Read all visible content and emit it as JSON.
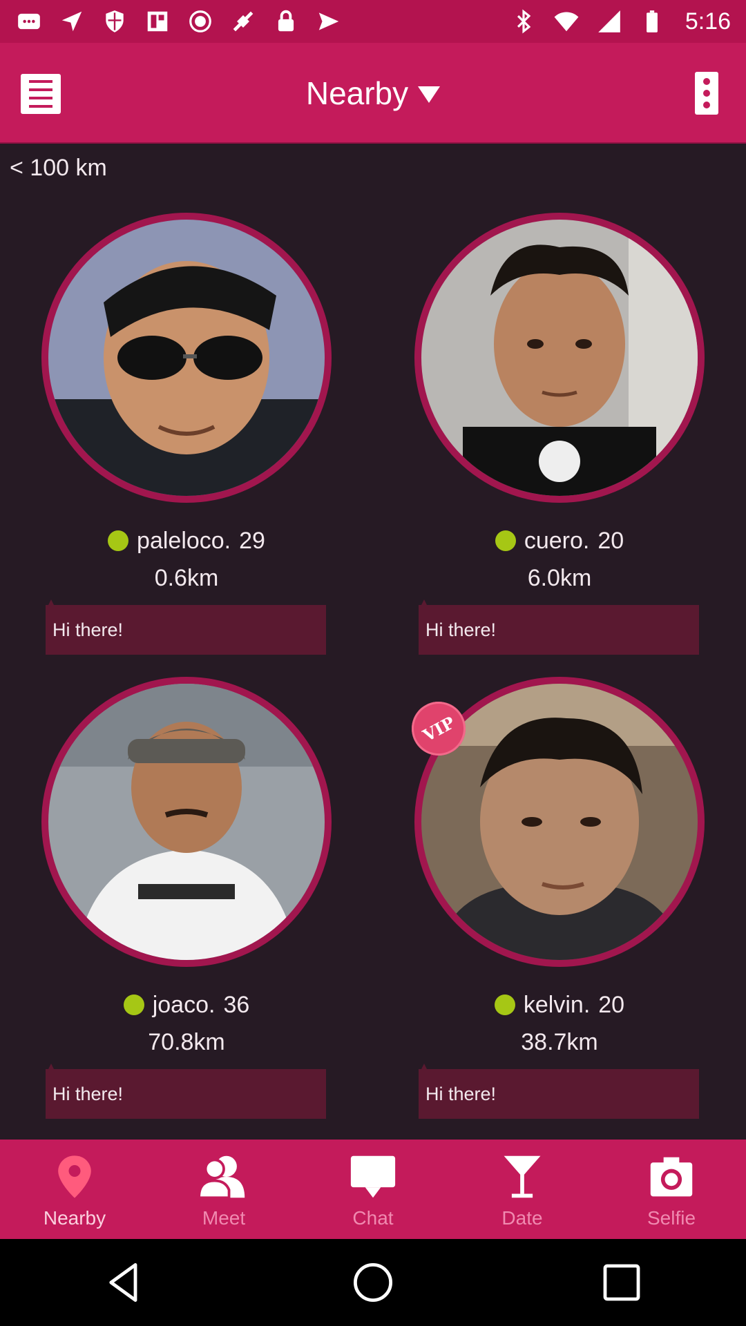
{
  "status_bar": {
    "time": "5:16",
    "icons": [
      "message-icon",
      "navigation-icon",
      "shield-icon",
      "news-icon",
      "record-icon",
      "fake-gps-icon",
      "lock-icon",
      "send-icon",
      "bluetooth-icon",
      "wifi-icon",
      "signal-icon",
      "battery-icon"
    ]
  },
  "header": {
    "title": "Nearby",
    "menu_icon": "list-icon",
    "more_icon": "more-vert-icon"
  },
  "filter": {
    "range_label": "< 100 km"
  },
  "users": [
    {
      "name": "paleloco.",
      "age": "29",
      "distance": "0.6km",
      "greeting": "Hi there!",
      "online": true,
      "vip": false
    },
    {
      "name": "cuero.",
      "age": "20",
      "distance": "6.0km",
      "greeting": "Hi there!",
      "online": true,
      "vip": false
    },
    {
      "name": "joaco.",
      "age": "36",
      "distance": "70.8km",
      "greeting": "Hi there!",
      "online": true,
      "vip": false
    },
    {
      "name": "kelvin.",
      "age": "20",
      "distance": "38.7km",
      "greeting": "Hi there!",
      "online": true,
      "vip": true,
      "badge": "VIP"
    }
  ],
  "nav": [
    {
      "label": "Nearby",
      "icon": "location-pin-icon",
      "active": true
    },
    {
      "label": "Meet",
      "icon": "people-icon",
      "active": false
    },
    {
      "label": "Chat",
      "icon": "chat-bubble-icon",
      "active": false
    },
    {
      "label": "Date",
      "icon": "cocktail-icon",
      "active": false
    },
    {
      "label": "Selfie",
      "icon": "camera-icon",
      "active": false
    }
  ],
  "colors": {
    "primary": "#c41b5b",
    "background": "#261a24",
    "online": "#a6c715",
    "greeting_bg": "#5a1930"
  }
}
